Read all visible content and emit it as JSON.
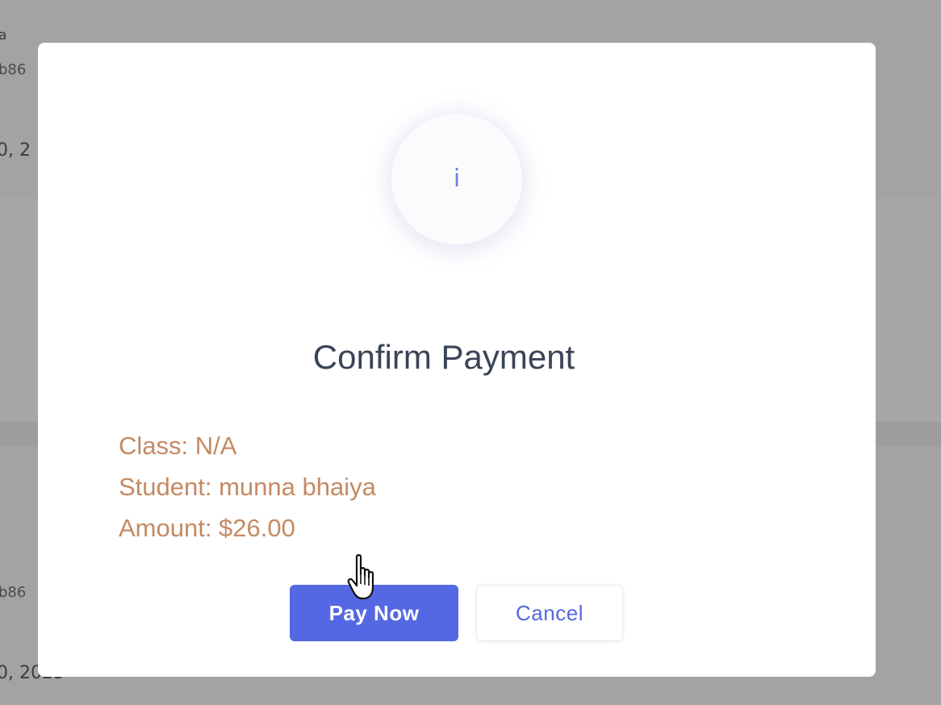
{
  "background": {
    "text_fragments": [
      "a",
      "b86",
      "0, 2",
      "b86",
      "0, 2025"
    ]
  },
  "dialog": {
    "icon": "info-icon",
    "icon_glyph": "i",
    "title": "Confirm Payment",
    "details": {
      "class_line": "Class: N/A",
      "student_line": "Student: munna bhaiya",
      "amount_line": "Amount: $26.00"
    },
    "buttons": {
      "pay_label": "Pay Now",
      "cancel_label": "Cancel"
    }
  },
  "colors": {
    "accent": "#5568e3",
    "detail_text": "#c48a63",
    "title_text": "#3a4457",
    "overlay": "#a3a3a3"
  }
}
